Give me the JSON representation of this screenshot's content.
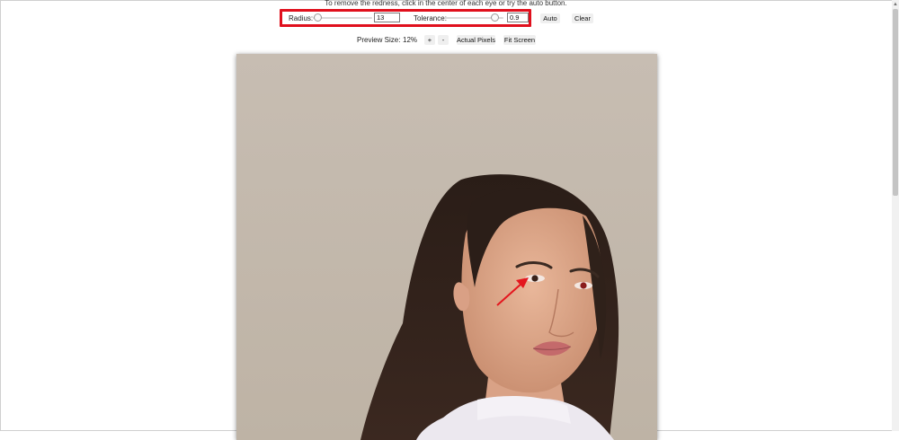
{
  "instructions": "To remove the redness, click in the center of each eye or try the auto button.",
  "controls": {
    "radius_label": "Radius:",
    "radius_value": "13",
    "radius_fraction": 0.02,
    "tolerance_label": "Tolerance:",
    "tolerance_value": "0.9",
    "tolerance_fraction": 0.9,
    "auto_label": "Auto",
    "clear_label": "Clear"
  },
  "preview": {
    "label": "Preview Size:",
    "percent": "12%",
    "zoom_in": "+",
    "zoom_out": "-",
    "actual_pixels": "Actual Pixels",
    "fit_screen": "Fit Screen"
  },
  "colors": {
    "highlight": "#e0101d",
    "annotation_arrow": "#e4161e"
  },
  "image": {
    "description_icon": "portrait-photo"
  }
}
